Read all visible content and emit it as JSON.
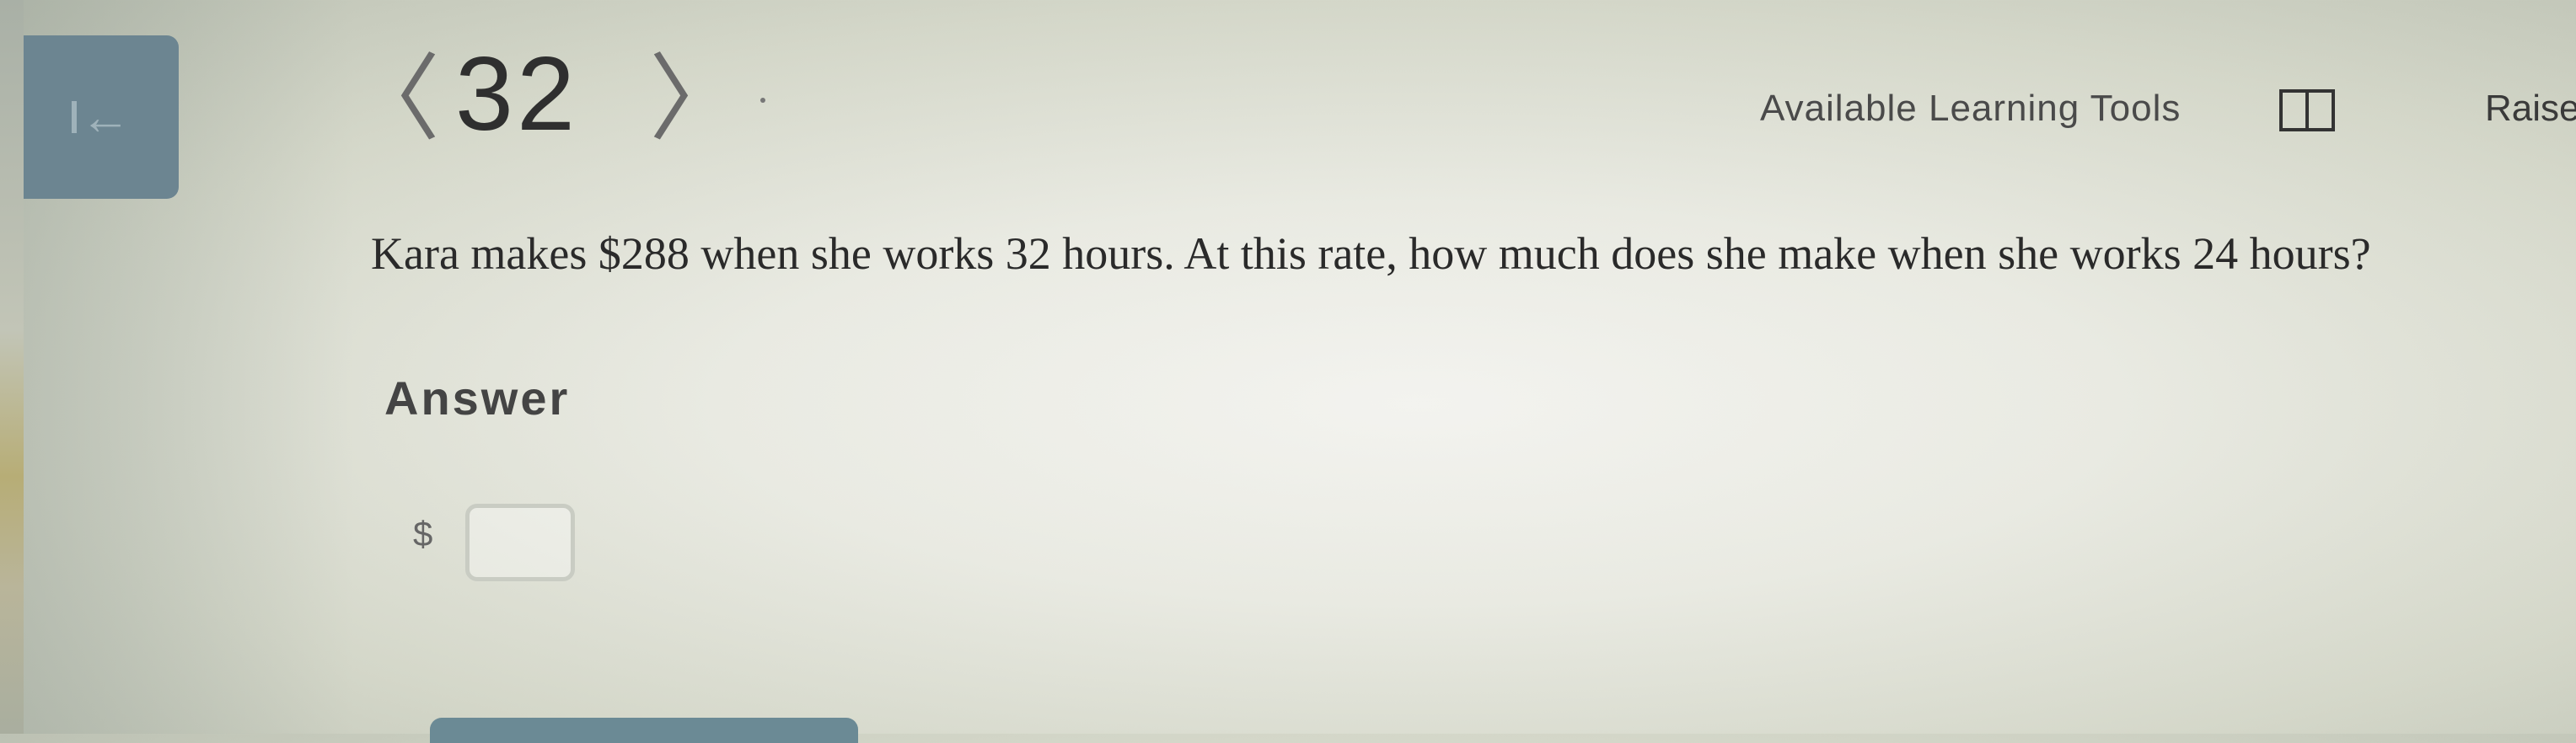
{
  "header": {
    "question_number": "32",
    "prev_glyph": "〈",
    "next_glyph": "〉",
    "tools_label": "Available Learning Tools",
    "raise_label": "Raise"
  },
  "question": {
    "text": "Kara makes $288 when she works 32 hours. At this rate, how much does she make when she works 24 hours?"
  },
  "answer": {
    "label": "Answer",
    "currency_symbol": "$",
    "value": ""
  },
  "icons": {
    "exit": "exit-arrow-icon",
    "tools": "book-icon"
  },
  "colors": {
    "exit_button": "#6c8591",
    "submit_strip": "#6b8a95"
  }
}
